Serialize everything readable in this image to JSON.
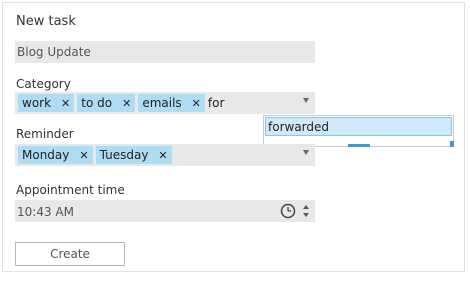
{
  "form": {
    "title": "New task",
    "subject_value": "Blog Update",
    "category": {
      "label": "Category",
      "tags": [
        "work",
        "to do",
        "emails"
      ],
      "typed_text": "for",
      "suggestion": "forwarded"
    },
    "reminder": {
      "label": "Reminder",
      "tags": [
        "Monday",
        "Tuesday"
      ]
    },
    "appointment": {
      "label": "Appointment time",
      "value": "10:43 AM"
    },
    "create_label": "Create",
    "tag_remove_glyph": "✕"
  },
  "icons": {
    "dropdown": "chevron-down-icon",
    "remove": "close-icon",
    "clock": "clock-icon",
    "spin_up": "spin-up-icon",
    "spin_down": "spin-down-icon"
  },
  "colors": {
    "tag_bg": "#aedcf3",
    "field_bg": "#e8e8e8",
    "suggestion_bg": "#cfe9f8",
    "accent": "#3d99d7"
  }
}
